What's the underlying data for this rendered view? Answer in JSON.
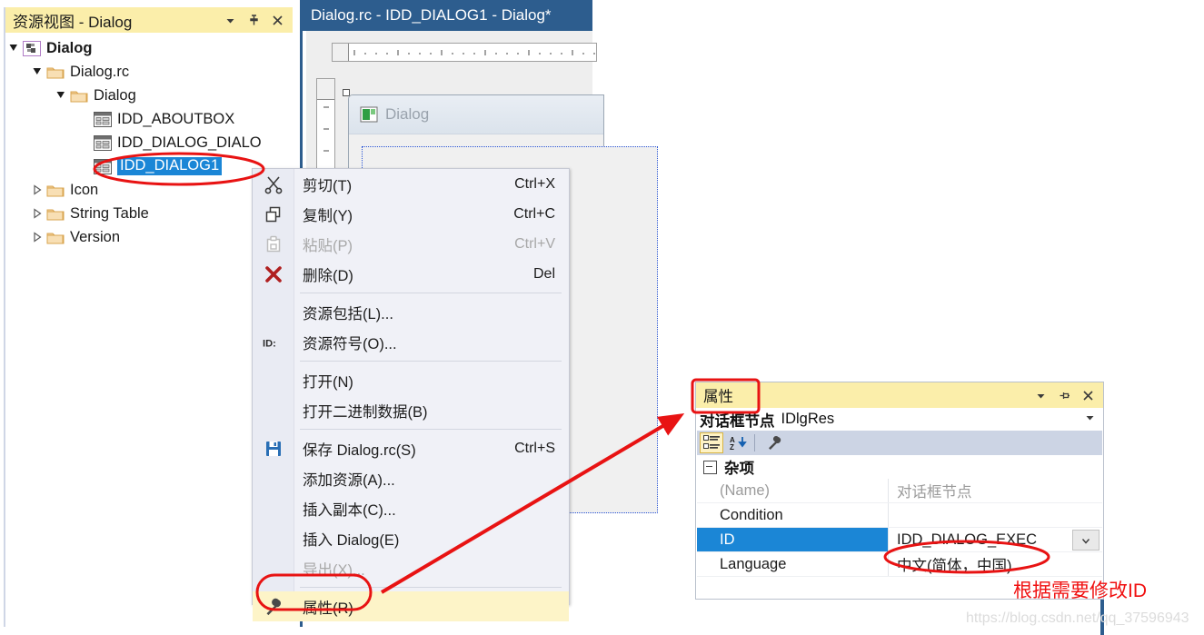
{
  "resource_view": {
    "title": "资源视图 - Dialog",
    "buttons": [
      {
        "name": "chevron-down-icon",
        "label": "▾"
      },
      {
        "name": "pin-icon",
        "label": "pin"
      },
      {
        "name": "close-icon",
        "label": "✕"
      }
    ],
    "tree": [
      {
        "label": "Dialog",
        "icon": "solution-icon",
        "indent": 0,
        "expander": "expanded",
        "bold": true,
        "selected": false
      },
      {
        "label": "Dialog.rc",
        "icon": "folder-icon",
        "indent": 1,
        "expander": "expanded",
        "bold": false,
        "selected": false
      },
      {
        "label": "Dialog",
        "icon": "folder-icon",
        "indent": 2,
        "expander": "expanded",
        "bold": false,
        "selected": false
      },
      {
        "label": "IDD_ABOUTBOX",
        "icon": "dialog-resource-icon",
        "indent": 3,
        "expander": "none",
        "bold": false,
        "selected": false
      },
      {
        "label": "IDD_DIALOG_DIALO",
        "icon": "dialog-resource-icon",
        "indent": 3,
        "expander": "none",
        "bold": false,
        "selected": false
      },
      {
        "label": "IDD_DIALOG1",
        "icon": "dialog-resource-icon",
        "indent": 3,
        "expander": "none",
        "bold": false,
        "selected": true
      },
      {
        "label": "Icon",
        "icon": "folder-icon",
        "indent": 1,
        "expander": "collapsed",
        "bold": false,
        "selected": false
      },
      {
        "label": "String Table",
        "icon": "folder-icon",
        "indent": 1,
        "expander": "collapsed",
        "bold": false,
        "selected": false
      },
      {
        "label": "Version",
        "icon": "folder-icon",
        "indent": 1,
        "expander": "collapsed",
        "bold": false,
        "selected": false
      }
    ]
  },
  "editor": {
    "tab_label": "Dialog.rc - IDD_DIALOG1 - Dialog*",
    "dialog_preview_title": "Dialog"
  },
  "context_menu": {
    "items": [
      {
        "label": "剪切(T)",
        "accel": "Ctrl+X",
        "icon": "scissors-icon",
        "disabled": false,
        "highlight": false,
        "sep_after": false
      },
      {
        "label": "复制(Y)",
        "accel": "Ctrl+C",
        "icon": "copy-icon",
        "disabled": false,
        "highlight": false,
        "sep_after": false
      },
      {
        "label": "粘贴(P)",
        "accel": "Ctrl+V",
        "icon": "paste-icon",
        "disabled": true,
        "highlight": false,
        "sep_after": false
      },
      {
        "label": "删除(D)",
        "accel": "Del",
        "icon": "delete-x-icon",
        "disabled": false,
        "highlight": false,
        "sep_after": true
      },
      {
        "label": "资源包括(L)...",
        "accel": "",
        "icon": "none",
        "disabled": false,
        "highlight": false,
        "sep_after": false
      },
      {
        "label": "资源符号(O)...",
        "accel": "",
        "icon": "id-symbol-icon",
        "disabled": false,
        "highlight": false,
        "sep_after": true
      },
      {
        "label": "打开(N)",
        "accel": "",
        "icon": "none",
        "disabled": false,
        "highlight": false,
        "sep_after": false
      },
      {
        "label": "打开二进制数据(B)",
        "accel": "",
        "icon": "none",
        "disabled": false,
        "highlight": false,
        "sep_after": true
      },
      {
        "label": "保存 Dialog.rc(S)",
        "accel": "Ctrl+S",
        "icon": "save-icon",
        "disabled": false,
        "highlight": false,
        "sep_after": false
      },
      {
        "label": "添加资源(A)...",
        "accel": "",
        "icon": "none",
        "disabled": false,
        "highlight": false,
        "sep_after": false
      },
      {
        "label": "插入副本(C)...",
        "accel": "",
        "icon": "none",
        "disabled": false,
        "highlight": false,
        "sep_after": false
      },
      {
        "label": "插入 Dialog(E)",
        "accel": "",
        "icon": "none",
        "disabled": false,
        "highlight": false,
        "sep_after": false
      },
      {
        "label": "导出(X)...",
        "accel": "",
        "icon": "none",
        "disabled": true,
        "highlight": false,
        "sep_after": true
      },
      {
        "label": "属性(R)",
        "accel": "",
        "icon": "wrench-icon",
        "disabled": false,
        "highlight": true,
        "sep_after": false
      }
    ]
  },
  "properties": {
    "title": "属性",
    "buttons": [
      {
        "name": "chevron-down-icon",
        "label": "▾"
      },
      {
        "name": "pin-icon",
        "label": "pin"
      },
      {
        "name": "close-icon",
        "label": "✕"
      }
    ],
    "object_name": "对话框节点",
    "object_type": "IDlgRes",
    "toolbar": [
      {
        "name": "categorized-view-button",
        "active": true
      },
      {
        "name": "alphabetical-sort-button",
        "active": false
      },
      {
        "name": "property-pages-button",
        "active": false
      }
    ],
    "category": "杂项",
    "rows": [
      {
        "name": "(Name)",
        "value": "对话框节点",
        "grayed": true,
        "selected": false,
        "dropdown": false
      },
      {
        "name": "Condition",
        "value": "",
        "grayed": false,
        "selected": false,
        "dropdown": false
      },
      {
        "name": "ID",
        "value": "IDD_DIALOG_EXEC",
        "grayed": false,
        "selected": true,
        "dropdown": true
      },
      {
        "name": "Language",
        "value": "中文(简体，中国)",
        "grayed": false,
        "selected": false,
        "dropdown": false
      }
    ]
  },
  "annotations": {
    "note": "根据需要修改ID",
    "watermark": "https://blog.csdn.net/qq_37596943",
    "accent_color": "#e81313"
  }
}
